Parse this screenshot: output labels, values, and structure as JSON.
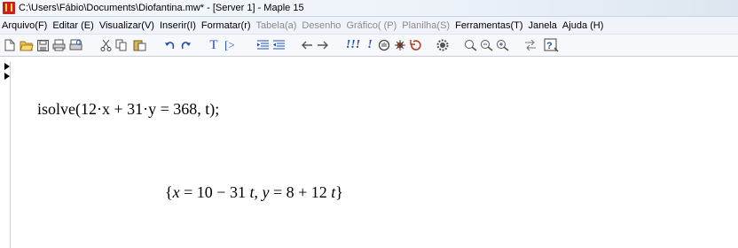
{
  "window": {
    "title": "C:\\Users\\Fábio\\Documents\\Diofantina.mw* - [Server 1] - Maple 15"
  },
  "menu": {
    "items": [
      {
        "label": "Arquivo(F)",
        "enabled": true
      },
      {
        "label": "Editar (E)",
        "enabled": true
      },
      {
        "label": "Visualizar(V)",
        "enabled": true
      },
      {
        "label": "Inserir(I)",
        "enabled": true
      },
      {
        "label": "Formatar(r)",
        "enabled": true
      },
      {
        "label": "Tabela(a)",
        "enabled": false
      },
      {
        "label": "Desenho",
        "enabled": false
      },
      {
        "label": "Gráfico( (P)",
        "enabled": false
      },
      {
        "label": "Planilha(S)",
        "enabled": false
      },
      {
        "label": "Ferramentas(T)",
        "enabled": true
      },
      {
        "label": "Janela",
        "enabled": true
      },
      {
        "label": "Ajuda (H)",
        "enabled": true
      }
    ]
  },
  "toolbar": {
    "text_button": "T",
    "math_button": "[>",
    "execute_all": "!!!",
    "execute": "!",
    "icons": [
      "new-document-icon",
      "open-folder-icon",
      "save-icon",
      "print-icon",
      "print-preview-icon",
      "cut-icon",
      "copy-icon",
      "paste-icon",
      "undo-icon",
      "redo-icon",
      "text-mode-icon",
      "math-prompt-icon",
      "indent-icon",
      "outdent-icon",
      "back-arrow-icon",
      "forward-arrow-icon",
      "execute-all-icon",
      "execute-icon",
      "stop-icon",
      "debug-icon",
      "restart-icon",
      "settings-icon",
      "zoom-100-icon",
      "zoom-150-icon",
      "zoom-200-icon",
      "toggle-icon",
      "help-icon"
    ]
  },
  "document": {
    "input": "isolve(12·x + 31·y = 368, t);",
    "output": {
      "open": "{",
      "x_var": "x",
      "x_eq": " = 10 − 31 ",
      "x_t": "t",
      "sep": ", ",
      "y_var": "y",
      "y_eq": " = 8 + 12 ",
      "y_t": "t",
      "close": "}"
    }
  },
  "colors": {
    "disabled_menu": "#8a8a8a",
    "toolbar_blue": "#1f4fb4",
    "app_icon": "#c8201e"
  }
}
